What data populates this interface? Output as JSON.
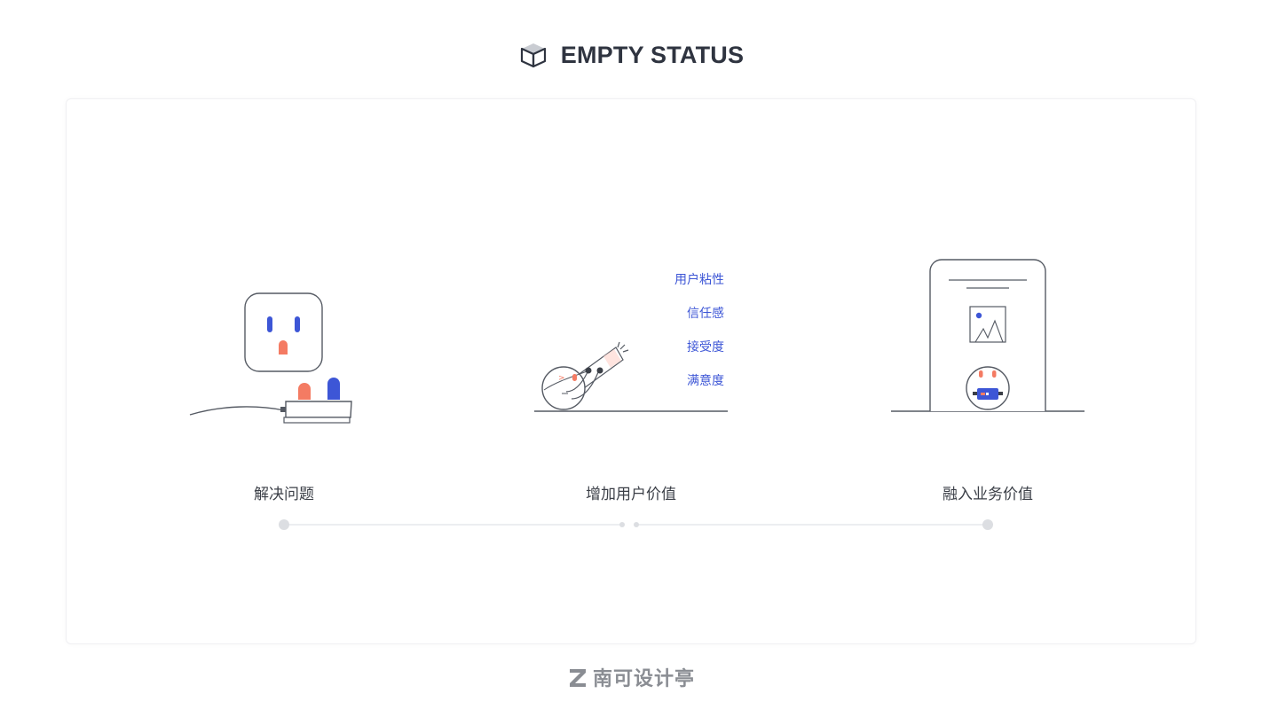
{
  "header": {
    "title": "EMPTY STATUS",
    "icon": "cube-icon"
  },
  "sections": [
    {
      "caption": "解决问题",
      "illustration": "power-socket-plug-illustration"
    },
    {
      "caption": "增加用户价值",
      "illustration": "telescope-character-illustration",
      "tags": [
        "用户粘性",
        "信任感",
        "接受度",
        "满意度"
      ]
    },
    {
      "caption": "融入业务价值",
      "illustration": "phone-character-illustration"
    }
  ],
  "footer": {
    "brand": "南可设计亭",
    "icon": "z-logo-icon"
  },
  "colors": {
    "accent_blue": "#3d56d6",
    "accent_coral": "#f47b63",
    "line_gray": "#555a63",
    "title": "#2f3440",
    "caption": "#3b3f47",
    "footer": "#8a8d93"
  }
}
